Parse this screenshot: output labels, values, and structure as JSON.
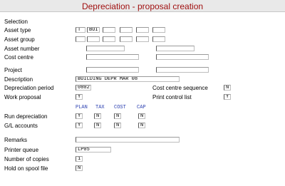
{
  "title": "Depreciation - proposal creation",
  "labels": {
    "selection": "Selection",
    "asset_type": "Asset type",
    "asset_group": "Asset group",
    "asset_number": "Asset number",
    "cost_centre": "Cost centre",
    "project": "Project",
    "description": "Description",
    "depreciation_period": "Depreciation period",
    "work_proposal": "Work proposal",
    "run_depreciation": "Run depreciation",
    "gl_accounts": "G/L accounts",
    "remarks": "Remarks",
    "printer_queue": "Printer queue",
    "number_of_copies": "Number of copies",
    "hold_on_spool": "Hold on spool file",
    "cost_centre_sequence": "Cost centre sequence",
    "print_control_list": "Print control list"
  },
  "columns": [
    "PLAN",
    "TAX",
    "COST",
    "CAP"
  ],
  "values": {
    "asset_type": [
      "T",
      "BUI",
      "",
      "",
      "",
      ""
    ],
    "asset_group": [
      "",
      "",
      "",
      "",
      "",
      ""
    ],
    "asset_number_from": "",
    "asset_number_to": "",
    "cost_centre_from": "",
    "cost_centre_to": "",
    "project_from": "",
    "project_to": "",
    "description": "BUILDING DEPR MAR 08",
    "depreciation_period": "0802",
    "work_proposal": "Y",
    "cost_centre_sequence": "N",
    "print_control_list": "Y",
    "run_depreciation": [
      "Y",
      "N",
      "N",
      "N"
    ],
    "gl_accounts": [
      "Y",
      "N",
      "N",
      "N"
    ],
    "remarks": "",
    "printer_queue": "LP05",
    "number_of_copies": "1",
    "hold_on_spool": "N"
  }
}
